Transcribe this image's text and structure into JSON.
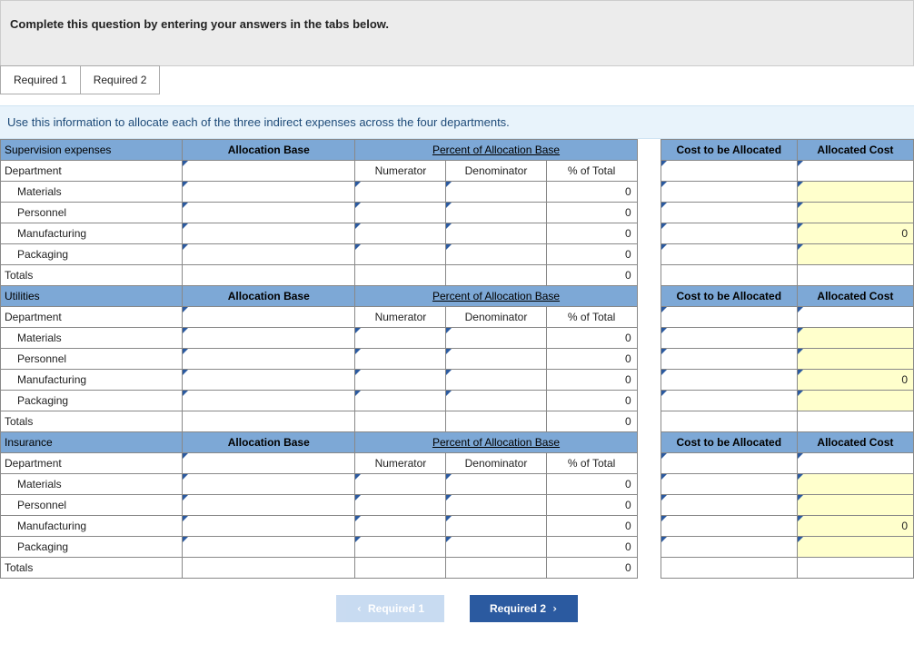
{
  "header": "Complete this question by entering your answers in the tabs below.",
  "tabs": [
    "Required 1",
    "Required 2"
  ],
  "help": "Use this information to allocate each of the three indirect expenses across the four departments.",
  "col_headers": {
    "allocation_base": "Allocation Base",
    "percent_base": "Percent of Allocation Base",
    "cost_alloc": "Cost to be Allocated",
    "allocated_cost": "Allocated Cost",
    "department": "Department",
    "numerator": "Numerator",
    "denominator": "Denominator",
    "pct_total": "% of Total"
  },
  "sections": [
    {
      "title": "Supervision expenses",
      "rows": [
        {
          "dept": "Materials",
          "pct": "0",
          "alloc": ""
        },
        {
          "dept": "Personnel",
          "pct": "0",
          "alloc": ""
        },
        {
          "dept": "Manufacturing",
          "pct": "0",
          "alloc": "0"
        },
        {
          "dept": "Packaging",
          "pct": "0",
          "alloc": ""
        }
      ],
      "totals_label": "Totals",
      "totals_pct": "0"
    },
    {
      "title": "Utilities",
      "rows": [
        {
          "dept": "Materials",
          "pct": "0",
          "alloc": ""
        },
        {
          "dept": "Personnel",
          "pct": "0",
          "alloc": ""
        },
        {
          "dept": "Manufacturing",
          "pct": "0",
          "alloc": "0"
        },
        {
          "dept": "Packaging",
          "pct": "0",
          "alloc": ""
        }
      ],
      "totals_label": "Totals",
      "totals_pct": "0"
    },
    {
      "title": "Insurance",
      "rows": [
        {
          "dept": "Materials",
          "pct": "0",
          "alloc": ""
        },
        {
          "dept": "Personnel",
          "pct": "0",
          "alloc": ""
        },
        {
          "dept": "Manufacturing",
          "pct": "0",
          "alloc": "0"
        },
        {
          "dept": "Packaging",
          "pct": "0",
          "alloc": ""
        }
      ],
      "totals_label": "Totals",
      "totals_pct": "0"
    }
  ],
  "nav": {
    "prev": "Required 1",
    "next": "Required 2"
  }
}
